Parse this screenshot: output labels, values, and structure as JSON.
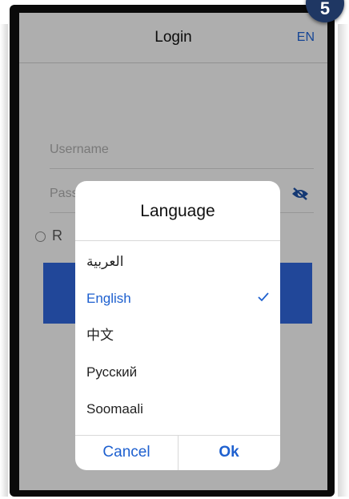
{
  "step_badge": "5",
  "header": {
    "title": "Login",
    "language_code": "EN"
  },
  "form": {
    "username_placeholder": "Username",
    "password_placeholder": "Password",
    "remember_label": "R"
  },
  "dialog": {
    "title": "Language",
    "options": [
      {
        "label": "العربية",
        "selected": false
      },
      {
        "label": "English",
        "selected": true
      },
      {
        "label": "中文",
        "selected": false
      },
      {
        "label": "Русский",
        "selected": false
      },
      {
        "label": "Soomaali",
        "selected": false
      }
    ],
    "cancel_label": "Cancel",
    "ok_label": "Ok"
  },
  "colors": {
    "accent": "#1e60cf",
    "button": "#2f63d4",
    "badge": "#1f3763"
  }
}
